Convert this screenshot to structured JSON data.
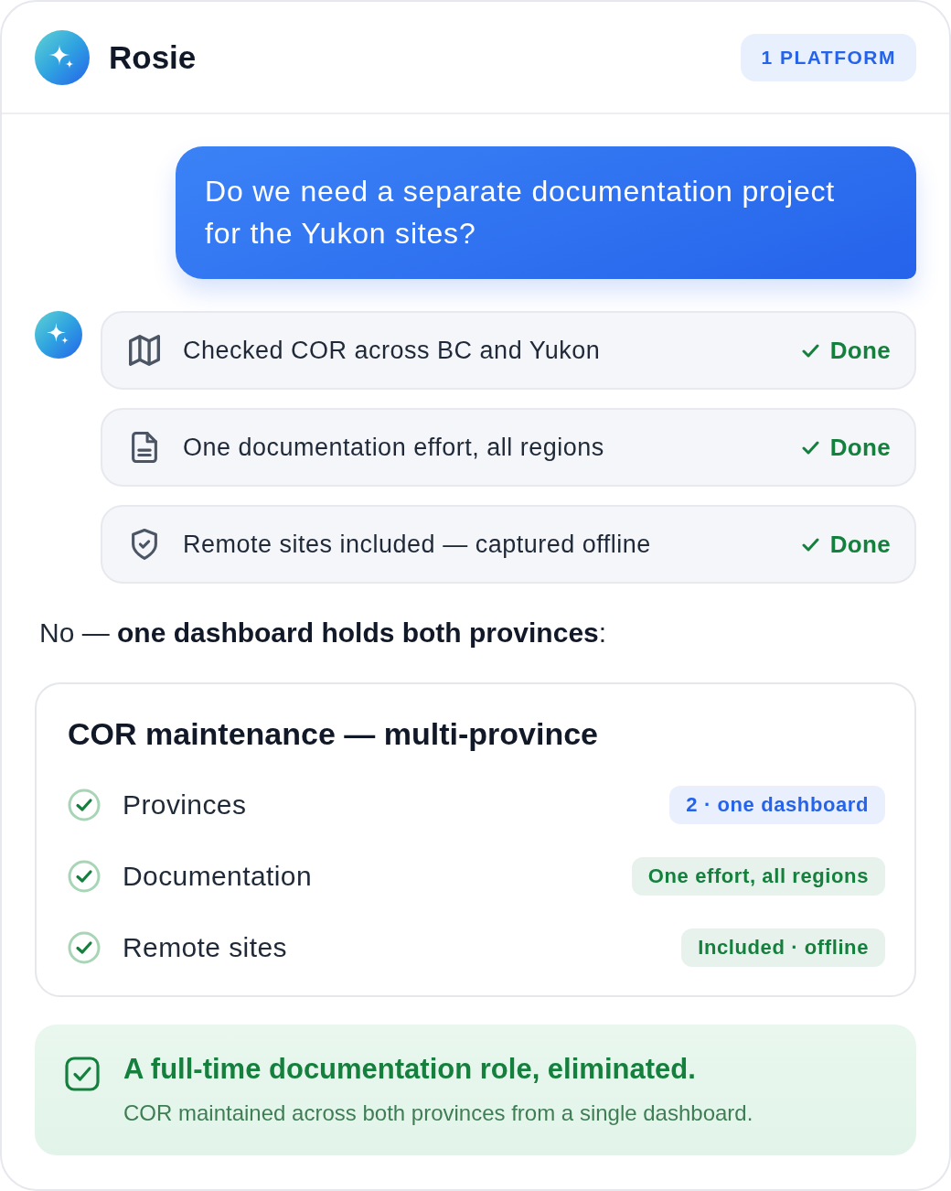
{
  "header": {
    "name": "Rosie",
    "badge": "1 PLATFORM"
  },
  "user_message": "Do we need a separate documentation project for the Yukon sites?",
  "steps": [
    {
      "kind": "map",
      "text": "Checked COR across BC and Yukon",
      "status": "Done",
      "done": true
    },
    {
      "kind": "document",
      "text": "One documentation effort, all regions",
      "status": "Done",
      "done": true
    },
    {
      "kind": "shield",
      "text": "Remote sites included — captured offline",
      "status": "Done",
      "done": true
    }
  ],
  "answer": "No — **one dashboard holds both provinces**:",
  "summary_card": {
    "title": "COR maintenance — multi-province",
    "rows": [
      {
        "label": "Provinces",
        "checked": true,
        "value": "2 · one dashboard",
        "color": "#2563eb"
      },
      {
        "label": "Documentation",
        "checked": true,
        "value": "One effort, all regions",
        "color": "#15803d"
      },
      {
        "label": "Remote sites",
        "checked": true,
        "value": "Included · offline",
        "color": "#15803d"
      }
    ]
  },
  "result": {
    "title": "A full-time documentation role, eliminated.",
    "text": "COR maintained across both provinces from a single dashboard."
  }
}
